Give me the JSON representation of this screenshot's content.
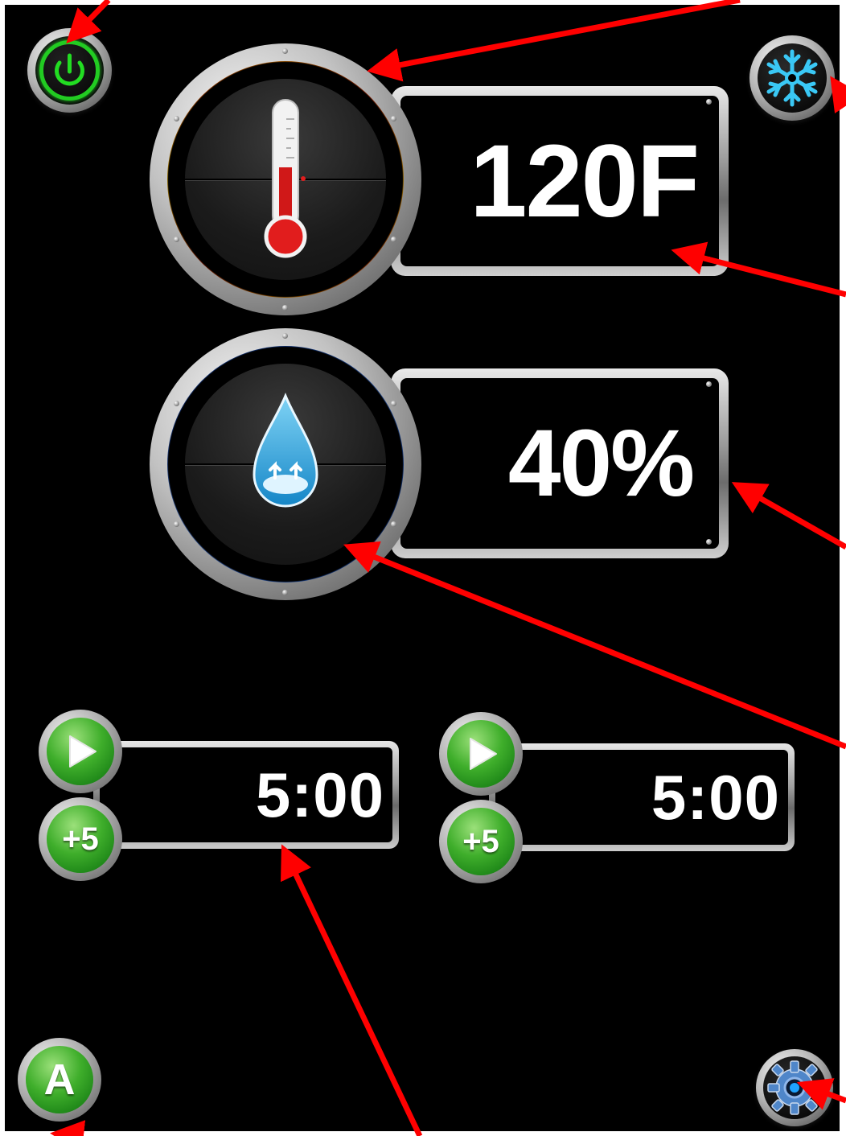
{
  "header": {
    "power_button_icon": "power-icon",
    "cool_button_icon": "snowflake-icon"
  },
  "temperature": {
    "icon": "thermometer-icon",
    "ring_theme": "flames",
    "value": "120F"
  },
  "humidity": {
    "icon": "water-drop-icon",
    "ring_theme": "water",
    "value": "40%"
  },
  "timers": [
    {
      "start_icon": "play-icon",
      "add_label": "+5",
      "value": "5:00"
    },
    {
      "start_icon": "play-icon",
      "add_label": "+5",
      "value": "5:00"
    }
  ],
  "footer": {
    "auto_label": "A",
    "settings_icon": "gear-icon"
  },
  "colors": {
    "background": "#000000",
    "power_green": "#22cc22",
    "snowflake_blue": "#3ac8f5",
    "button_green": "#3fae2b",
    "annotation_red": "#ff0000"
  }
}
